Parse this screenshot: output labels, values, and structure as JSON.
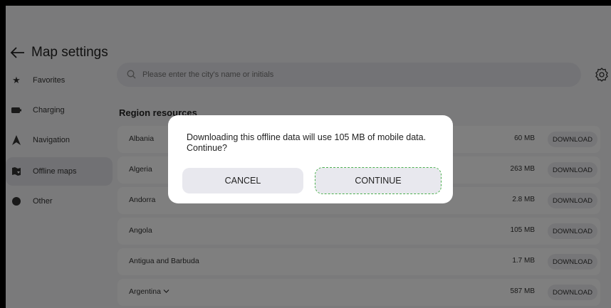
{
  "header": {
    "title": "Map settings",
    "back_icon": "arrow-left-icon"
  },
  "sidebar": {
    "items": [
      {
        "label": "Favorites",
        "icon": "star-icon",
        "active": false
      },
      {
        "label": "Charging",
        "icon": "battery-icon",
        "active": false
      },
      {
        "label": "Navigation",
        "icon": "navigation-arrow-icon",
        "active": false
      },
      {
        "label": "Offline maps",
        "icon": "offline-maps-icon",
        "active": true
      },
      {
        "label": "Other",
        "icon": "circle-icon",
        "active": false
      }
    ]
  },
  "search": {
    "placeholder": "Please enter the city's name or initials",
    "value": ""
  },
  "settings_icon": "gear-icon",
  "section": {
    "title": "Region resources"
  },
  "regions": [
    {
      "name": "Albania",
      "size": "60 MB",
      "action": "DOWNLOAD"
    },
    {
      "name": "Algeria",
      "size": "263 MB",
      "action": "DOWNLOAD"
    },
    {
      "name": "Andorra",
      "size": "2.8 MB",
      "action": "DOWNLOAD"
    },
    {
      "name": "Angola",
      "size": "105 MB",
      "action": "DOWNLOAD"
    },
    {
      "name": "Antigua and Barbuda",
      "size": "1.7 MB",
      "action": "DOWNLOAD"
    },
    {
      "name": "Argentina",
      "size": "587 MB",
      "action": "DOWNLOAD",
      "expandable": true
    }
  ],
  "dialog": {
    "message": "Downloading this offline data will use 105 MB of mobile data. Continue?",
    "cancel_label": "CANCEL",
    "continue_label": "CONTINUE"
  },
  "colors": {
    "overlay": "#000000",
    "focus_outline": "#4caf50",
    "background": "#f4f4f6"
  }
}
